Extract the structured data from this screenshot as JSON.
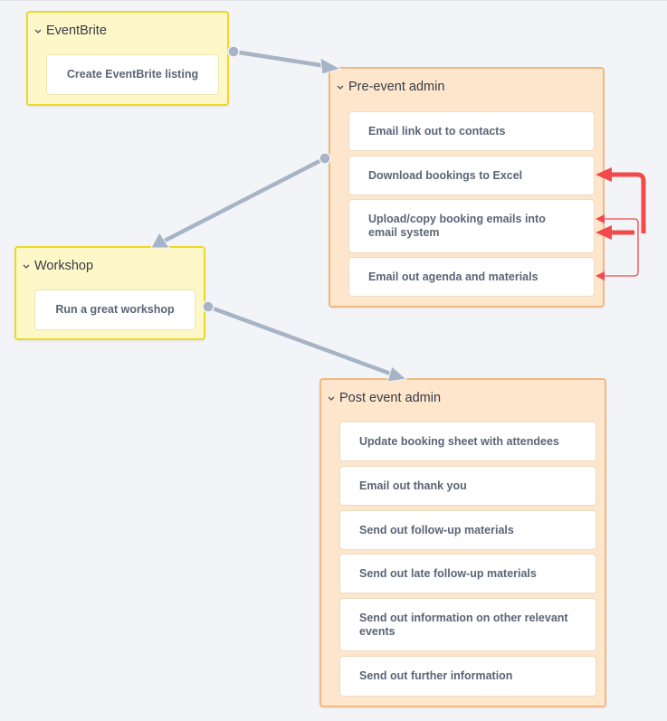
{
  "colors": {
    "background": "#f3f4f8",
    "connector": "#a6b4c6",
    "dependency": "#f24a4a",
    "yellow_group_bg": "#fef8c9",
    "yellow_group_border": "#ecd928",
    "orange_group_bg": "#fee6cc",
    "orange_group_border": "#efba80"
  },
  "groups": {
    "eventbrite": {
      "title": "EventBrite",
      "icon": "chevron-down-icon",
      "items": [
        "Create EventBrite listing"
      ]
    },
    "pre_event": {
      "title": "Pre-event admin",
      "icon": "chevron-down-icon",
      "items": [
        "Email link out to contacts",
        "Download bookings to Excel",
        "Upload/copy booking emails into email system",
        "Email out agenda and materials"
      ]
    },
    "workshop": {
      "title": "Workshop",
      "icon": "chevron-down-icon",
      "items": [
        "Run a great workshop"
      ]
    },
    "post_event": {
      "title": "Post event admin",
      "icon": "chevron-down-icon",
      "items": [
        "Update booking sheet with attendees",
        "Email out thank you",
        "Send out follow-up materials",
        "Send out late follow-up materials",
        "Send out information on other relevant events",
        "Send out further information"
      ]
    }
  },
  "connections": [
    {
      "from": "EventBrite",
      "to": "Pre-event admin",
      "type": "flow"
    },
    {
      "from": "Pre-event admin",
      "to": "Workshop",
      "type": "flow"
    },
    {
      "from": "Workshop",
      "to": "Post event admin",
      "type": "flow"
    },
    {
      "from": "Upload/copy booking emails into email system",
      "to": "Download bookings to Excel",
      "type": "dependency-strong"
    },
    {
      "from": "Upload/copy booking emails into email system",
      "to": "Upload/copy booking emails into email system",
      "type": "dependency-strong"
    },
    {
      "from": "Email out agenda and materials",
      "to": "Upload/copy booking emails into email system",
      "type": "dependency-weak"
    }
  ]
}
